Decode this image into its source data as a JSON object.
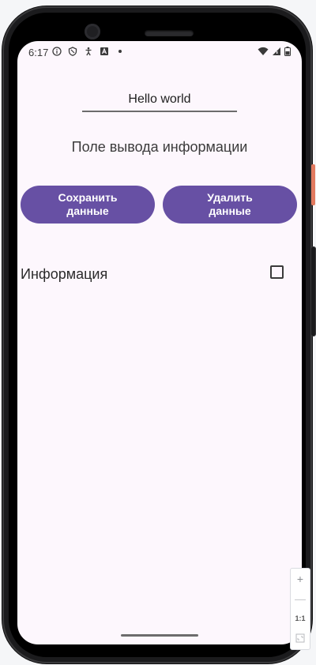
{
  "status_bar": {
    "time": "6:17",
    "left_icons": [
      "info-icon",
      "shield-icon",
      "accessibility-icon",
      "font-icon",
      "dot-icon"
    ],
    "right_icons": [
      "wifi-icon",
      "signal-icon",
      "battery-icon"
    ]
  },
  "input": {
    "value": "Hello world"
  },
  "output": {
    "text": "Поле вывода информации"
  },
  "buttons": {
    "save_label": "Сохранить\nданные",
    "delete_label": "Удалить\nданные"
  },
  "info": {
    "label": "Информация",
    "checked": false
  },
  "zoom_controls": {
    "zoom_in": "+",
    "zoom_out": "—",
    "actual_size": "1:1",
    "fit_icon": "fit-screen-icon"
  },
  "colors": {
    "primary": "#6750a4",
    "screen_background": "#fdf7fd",
    "frame": "#1b1b1d",
    "power_button": "#e27a5f"
  }
}
